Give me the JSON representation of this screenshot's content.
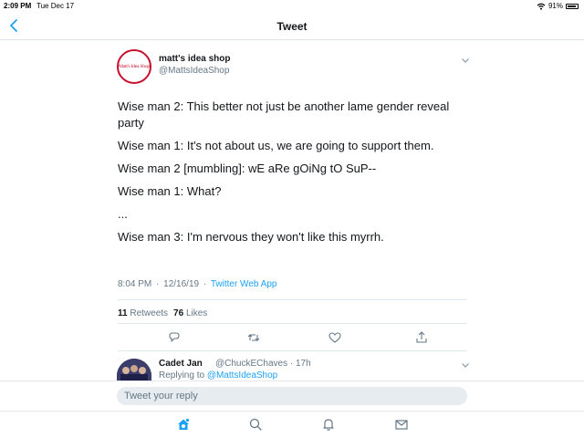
{
  "status_bar": {
    "time": "2:09 PM",
    "date": "Tue Dec 17",
    "battery_percent": "91%",
    "battery_level": 0.91
  },
  "nav": {
    "title": "Tweet",
    "back_icon": "chevron-left-icon"
  },
  "tweet": {
    "avatar_text": "Matt's Idea Shop",
    "author_name": "matt's idea shop",
    "author_handle": "@MattsIdeaShop",
    "lines": [
      "Wise man 2: This better not just be another lame gender reveal party",
      "Wise man 1: It's not about us, we are going to support them.",
      "Wise man 2 [mumbling]: wE aRe gOiNg tO SuP--",
      "Wise man 1: What?",
      "...",
      "Wise man 3: I'm nervous they won't like this myrrh."
    ],
    "time": "8:04 PM",
    "separator": "·",
    "date": "12/16/19",
    "source": "Twitter Web App",
    "retweets_count": "11",
    "retweets_label": "Retweets",
    "likes_count": "76",
    "likes_label": "Likes"
  },
  "reply": {
    "author_name": "Cadet Jan",
    "author_handle": "@ChuckEChaves · 17h",
    "replying_to_prefix": "Replying to",
    "replying_to_mention": "@MattsIdeaShop"
  },
  "compose": {
    "placeholder": "Tweet your reply"
  },
  "colors": {
    "accent": "#1da1f2",
    "secondary_text": "#657786",
    "border": "#e1e8ed",
    "avatar_ring": "#c8102e"
  },
  "icons": {
    "actions": [
      "reply-icon",
      "retweet-icon",
      "like-icon",
      "share-icon"
    ],
    "tabs": [
      "home-icon",
      "search-icon",
      "notifications-icon",
      "messages-icon"
    ]
  }
}
